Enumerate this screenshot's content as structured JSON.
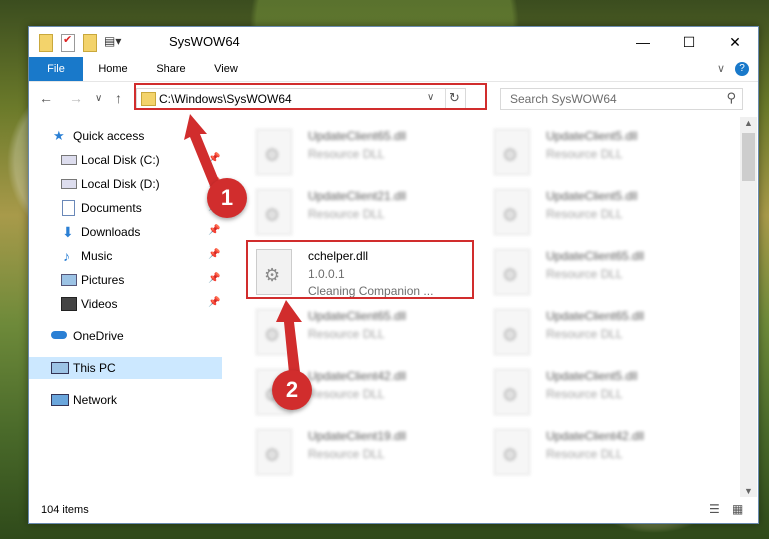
{
  "window": {
    "title": "SysWOW64",
    "minimize_glyph": "—",
    "maximize_glyph": "☐",
    "close_glyph": "✕"
  },
  "ribbon": {
    "tabs": [
      "File",
      "Home",
      "Share",
      "View"
    ],
    "expand_glyph": "∨",
    "help_glyph": "?"
  },
  "nav": {
    "back": "←",
    "forward": "→",
    "recent": "∨",
    "up": "↑",
    "address": "C:\\Windows\\SysWOW64",
    "address_dropdown": "∨",
    "refresh": "↻",
    "search_placeholder": "Search SysWOW64",
    "search_glyph": "⚲"
  },
  "sidebar": {
    "items": [
      {
        "label": "Quick access",
        "icon": "star-icon",
        "pin": ""
      },
      {
        "label": "Local Disk (C:)",
        "icon": "drive-icon",
        "pin": "📌"
      },
      {
        "label": "Local Disk (D:)",
        "icon": "drive-icon",
        "pin": "📌"
      },
      {
        "label": "Documents",
        "icon": "documents-icon",
        "pin": "📌"
      },
      {
        "label": "Downloads",
        "icon": "downloads-icon",
        "pin": "📌"
      },
      {
        "label": "Music",
        "icon": "music-icon",
        "pin": "📌"
      },
      {
        "label": "Pictures",
        "icon": "pictures-icon",
        "pin": "📌"
      },
      {
        "label": "Videos",
        "icon": "videos-icon",
        "pin": "📌"
      },
      {
        "label": "OneDrive",
        "icon": "cloud-icon",
        "pin": ""
      },
      {
        "label": "This PC",
        "icon": "computer-icon",
        "pin": ""
      },
      {
        "label": "Network",
        "icon": "network-icon",
        "pin": ""
      }
    ]
  },
  "files": [
    {
      "name": "UpdateClient65.dll",
      "line1": "Resource DLL",
      "line2": ""
    },
    {
      "name": "UpdateClient5.dll",
      "line1": "Resource DLL",
      "line2": ""
    },
    {
      "name": "UpdateClient21.dll",
      "line1": "Resource DLL",
      "line2": ""
    },
    {
      "name": "UpdateClient5.dll",
      "line1": "Resource DLL",
      "line2": ""
    },
    {
      "name": "cchelper.dll",
      "line1": "1.0.0.1",
      "line2": "Cleaning Companion ..."
    },
    {
      "name": "UpdateClient65.dll",
      "line1": "Resource DLL",
      "line2": ""
    },
    {
      "name": "UpdateClient65.dll",
      "line1": "Resource DLL",
      "line2": ""
    },
    {
      "name": "UpdateClient65.dll",
      "line1": "Resource DLL",
      "line2": ""
    },
    {
      "name": "UpdateClient42.dll",
      "line1": "Resource DLL",
      "line2": ""
    },
    {
      "name": "UpdateClient5.dll",
      "line1": "Resource DLL",
      "line2": ""
    },
    {
      "name": "UpdateClient19.dll",
      "line1": "Resource DLL",
      "line2": ""
    },
    {
      "name": "UpdateClient42.dll",
      "line1": "Resource DLL",
      "line2": ""
    }
  ],
  "status": {
    "item_count": "104 items",
    "view_details": "☰",
    "view_tiles": "▦"
  },
  "annotations": {
    "step1": "1",
    "step2": "2",
    "accent_color": "#d12d2d"
  },
  "colors": {
    "file_tab": "#1979ca",
    "selected": "#cce8ff"
  }
}
